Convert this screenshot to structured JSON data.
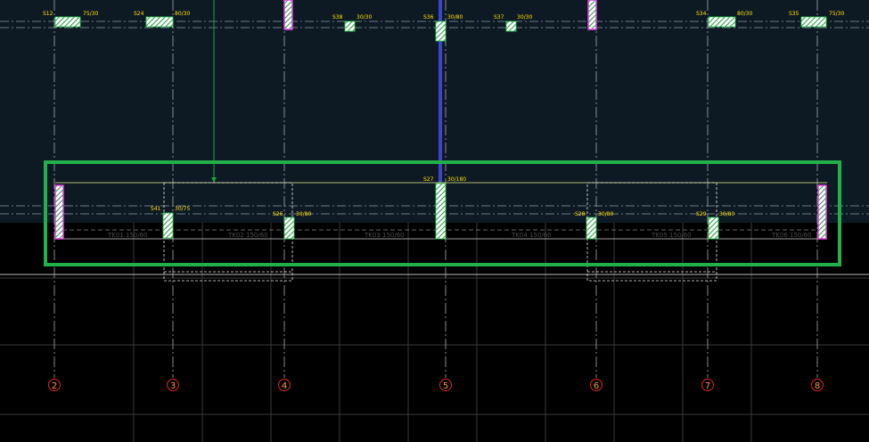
{
  "colors": {
    "upper_background": "#0d1a24",
    "lower_background": "#000000",
    "column_label": "#ffe000",
    "beam_label": "#4a4a4a",
    "axis_bubble": "#ff9a2e",
    "selection": "#22b04a",
    "column_fill": "#28c84a",
    "wall_edge": "#e040e0"
  },
  "axes": [
    "2",
    "3",
    "4",
    "5",
    "6",
    "7",
    "8"
  ],
  "top_columns": [
    {
      "name": "S12",
      "size": "75/30"
    },
    {
      "name": "S24",
      "size": "80/30"
    },
    {
      "name": "S38",
      "size": "30/30"
    },
    {
      "name": "S36",
      "size": "30/80"
    },
    {
      "name": "S37",
      "size": "30/30"
    },
    {
      "name": "S34",
      "size": "80/30"
    },
    {
      "name": "S35",
      "size": "75/30"
    }
  ],
  "lower_columns": [
    {
      "name": "S41",
      "size": "30/75"
    },
    {
      "name": "S26",
      "size": "30/80"
    },
    {
      "name": "S27",
      "size": "30/180"
    },
    {
      "name": "S28",
      "size": "30/80"
    },
    {
      "name": "S29",
      "size": "30/80"
    }
  ],
  "beams": [
    {
      "label": "TK01 150/60"
    },
    {
      "label": "TK02 150/60"
    },
    {
      "label": "TK03 150/60"
    },
    {
      "label": "TK04 150/60"
    },
    {
      "label": "TK05 150/60"
    },
    {
      "label": "TK06 150/60"
    }
  ]
}
